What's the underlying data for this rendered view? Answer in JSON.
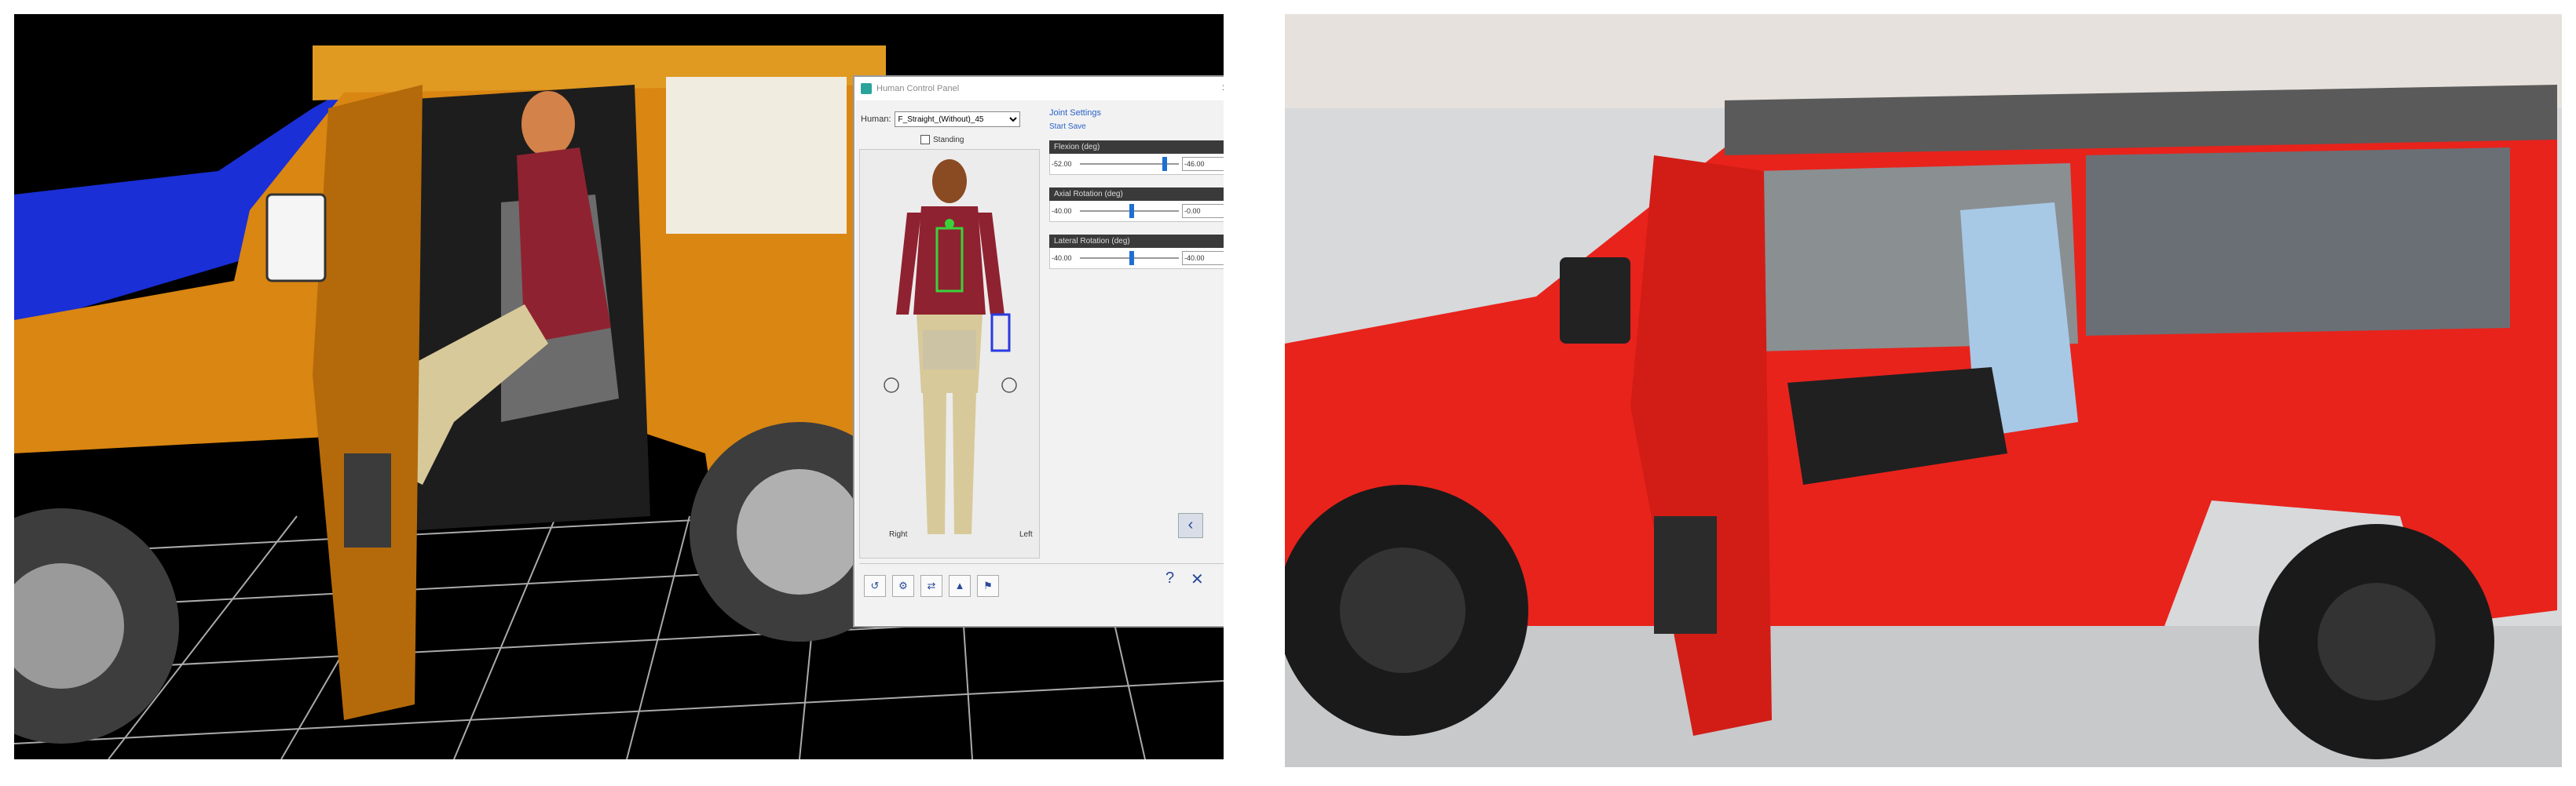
{
  "panel": {
    "title": "Human Control Panel",
    "human_label": "Human:",
    "human_value": "F_Straight_(Without)_45",
    "standing_label": "Standing",
    "joint_settings": "Joint Settings",
    "start_save": "Start  Save",
    "groups": [
      {
        "name": "Flexion (deg)",
        "min": "-52.00",
        "value": "-46.00",
        "position": 0.83
      },
      {
        "name": "Axial Rotation (deg)",
        "min": "-40.00",
        "value": "-0.00",
        "position": 0.5
      },
      {
        "name": "Lateral Rotation (deg)",
        "min": "-40.00",
        "value": "-40.00",
        "position": 0.5
      }
    ],
    "right_label": "Right",
    "left_label": "Left",
    "help_icon": "question-icon",
    "close_icon": "close-icon",
    "collapse_icon": "chevron-left-icon"
  },
  "colors": {
    "vehicle_orange": "#d98612",
    "vehicle_blue": "#1a2fd6",
    "manikin_shirt": "#8f2230",
    "manikin_pants": "#d7c99a",
    "vehicle_red": "#e8231c",
    "accent_blue": "#1f6fd1"
  }
}
